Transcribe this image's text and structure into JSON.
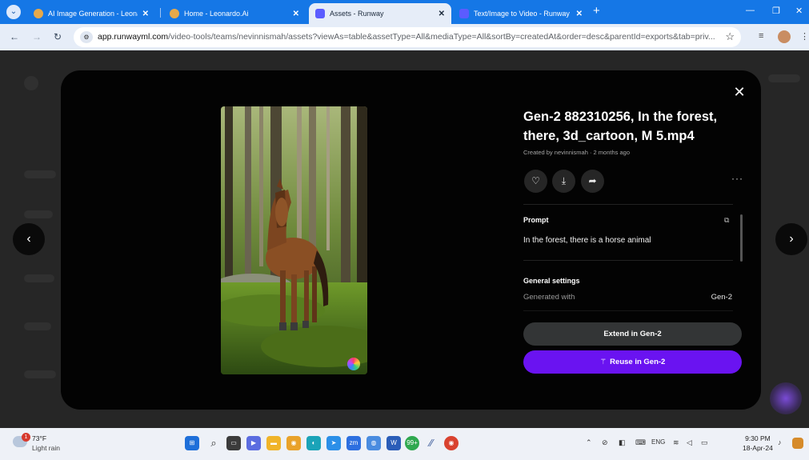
{
  "browser": {
    "tabs": [
      {
        "title": "AI Image Generation - Leonardo",
        "active": false
      },
      {
        "title": "Home - Leonardo.Ai",
        "active": false
      },
      {
        "title": "Assets - Runway",
        "active": true
      },
      {
        "title": "Text/Image to Video - Runway",
        "active": false
      }
    ],
    "url_domain": "app.runwayml.com",
    "url_path": "/video-tools/teams/nevinnismah/assets?viewAs=table&assetType=All&mediaType=All&sortBy=createdAt&order=desc&parentId=exports&tab=priv..."
  },
  "modal": {
    "title": "Gen-2 882310256, In the forest, there, 3d_cartoon, M 5.mp4",
    "meta": "Created by nevinnismah · 2 months ago",
    "prompt_label": "Prompt",
    "prompt_text": "In the forest, there is a horse animal",
    "settings_label": "General settings",
    "settings": [
      {
        "label": "Generated with",
        "value": "Gen-2"
      }
    ],
    "extend_label": "Extend in Gen-2",
    "reuse_label": "Reuse in Gen-2"
  },
  "taskbar": {
    "weather_temp": "73°F",
    "weather_condition": "Light rain",
    "weather_badge": "1",
    "language": "ENG",
    "time": "9:30 PM",
    "date": "18-Apr-24",
    "chrome_badge": "99+"
  },
  "colors": {
    "browser_accent": "#1577e6",
    "modal_bg": "#030303",
    "reuse_button": "#6a13f1",
    "extend_button": "#333536"
  }
}
